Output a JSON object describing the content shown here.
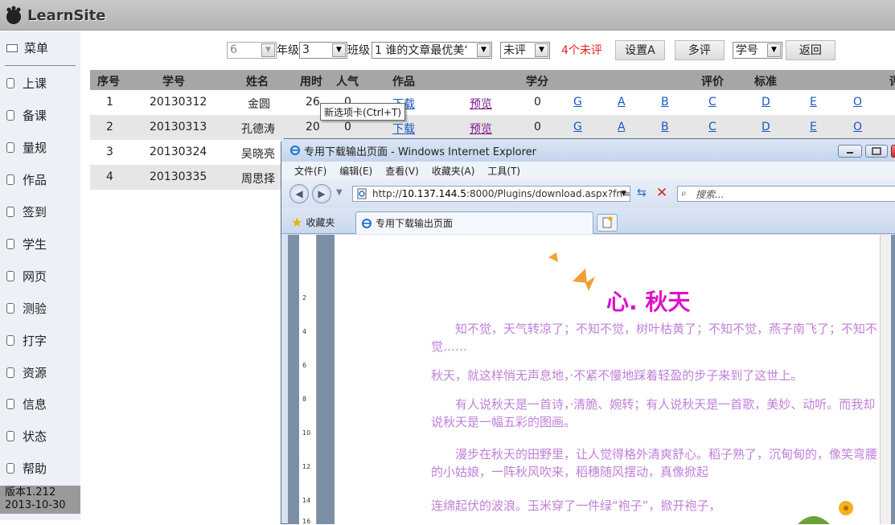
{
  "app": {
    "logo": "LearnSite"
  },
  "sidebar": {
    "menu_label": "菜单",
    "items": [
      {
        "label": "上课"
      },
      {
        "label": "备课"
      },
      {
        "label": "量规"
      },
      {
        "label": "作品"
      },
      {
        "label": "签到"
      },
      {
        "label": "学生"
      },
      {
        "label": "网页"
      },
      {
        "label": "测验"
      },
      {
        "label": "打字"
      },
      {
        "label": "资源"
      },
      {
        "label": "信息"
      },
      {
        "label": "状态"
      },
      {
        "label": "帮助"
      }
    ],
    "version": "版本1.212",
    "date": "2013-10-30"
  },
  "toolbar": {
    "grade_value": "6",
    "grade_label": "年级",
    "class_value": "3",
    "class_label": "班级",
    "work_value": "1 谁的文章最优美‘",
    "filter_value": "未评",
    "unrated": "4个未评",
    "set_a": "设置A",
    "multi_rate": "多评",
    "sort_value": "学号",
    "back": "返回"
  },
  "table": {
    "headers": {
      "seq": "序号",
      "id": "学号",
      "name": "姓名",
      "time": "用时",
      "pop": "人气",
      "work": "作品",
      "score": "学分",
      "rate": "评价",
      "std": "标准",
      "more": "评"
    },
    "rows": [
      {
        "seq": "1",
        "id": "20130312",
        "name": "金圆",
        "time": "26",
        "pop": "0",
        "download": "下载",
        "preview": "预览",
        "score": "0",
        "g": "G",
        "a": "A",
        "b": "B",
        "c": "C",
        "d": "D",
        "e": "E",
        "o": "O"
      },
      {
        "seq": "2",
        "id": "20130313",
        "name": "孔德涛",
        "time": "20",
        "pop": "0",
        "download": "下载",
        "preview": "预览",
        "score": "0",
        "g": "G",
        "a": "A",
        "b": "B",
        "c": "C",
        "d": "D",
        "e": "E",
        "o": "O"
      },
      {
        "seq": "3",
        "id": "20130324",
        "name": "吴晓亮"
      },
      {
        "seq": "4",
        "id": "20130335",
        "name": "周思择"
      }
    ]
  },
  "ie": {
    "title": "专用下载输出页面 - Windows Internet Explorer",
    "menu": [
      "文件(F)",
      "编辑(E)",
      "查看(V)",
      "收藏夹(A)",
      "工具(T)"
    ],
    "url_prefix": "http://",
    "url_host": "10.137.144.5",
    "url_rest": ":8000/Plugins/download.aspx?fn=",
    "search_placeholder": "搜索...",
    "favorites": "收藏夹",
    "tab_title": "专用下载输出页面",
    "tooltip": "新选项卡(Ctrl+T)",
    "doc_title": "心. 秋天",
    "paragraphs": [
      "　　知不觉，天气转凉了；不知不觉，树叶枯黄了；不知不觉，燕子南飞了；不知不觉……",
      "秋天，就这样悄无声息地，·不紧不慢地踩着轻盈的步子来到了这世上。",
      "　　有人说秋天是一首诗，·清脆、婉转；有人说秋天是一首歌，美妙、动听。而我却说秋天是一幅五彩的图画。",
      "　　漫步在秋天的田野里，让人觉得格外清爽舒心。稻子熟了，沉甸甸的，像笑弯腰的小姑娘，一阵秋风吹来，稻穗随风摆动，真像掀起",
      "连绵起伏的波浪。玉米穿了一件绿“袍子”，掀开袍子，"
    ],
    "ruler_marks": [
      "2",
      "4",
      "6",
      "8",
      "10",
      "12",
      "14",
      "16"
    ]
  }
}
